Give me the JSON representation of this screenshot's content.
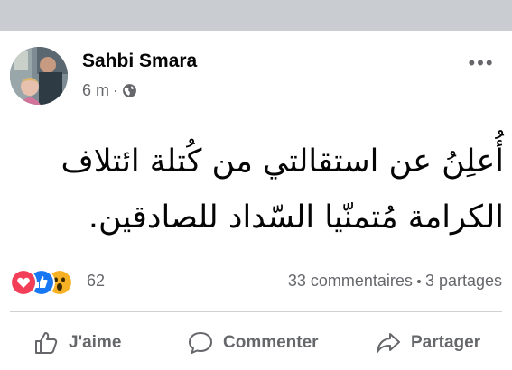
{
  "post": {
    "author": "Sahbi Smara",
    "time": "6 m",
    "privacy_icon": "public-globe-icon",
    "more_label": "•••",
    "text_lines": [
      "أُعلِنُ عن استقالتي من كُتلة ائتلاف",
      "الكرامة مُتمنّيا السّداد للصادقين."
    ],
    "reaction_count": "62",
    "comments": "33 commentaires",
    "shares": "3 partages"
  },
  "actions": {
    "like": "J'aime",
    "comment": "Commenter",
    "share": "Partager"
  },
  "colors": {
    "secondary_text": "#65676b",
    "love": "#f33e58",
    "like": "#1877f2",
    "wow": "#f7b125",
    "divider": "#ced0d4"
  }
}
